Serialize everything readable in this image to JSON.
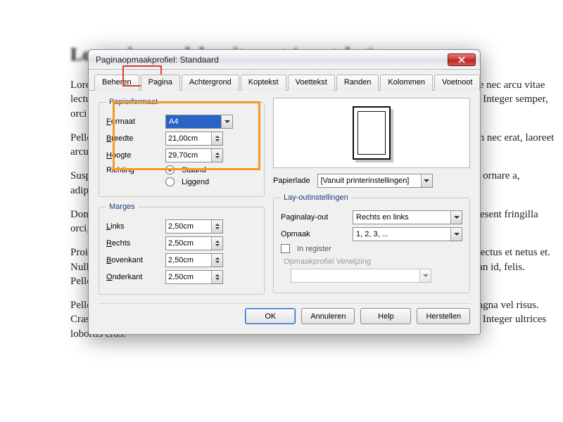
{
  "doc": {
    "title": "Lorem ipsum dolor sit amet (any tekst)",
    "para1": "Lorem ipsum dolor sit amet, consectetur adipiscing elit. Suspendisse at libero neque massa. Fusce nec arcu vitae lectus adipiscing vitae lorem. Sed aliquet faucibus pede, sit amet commodo magna tincidunt non. Integer semper, orci id tempor quis, lorem.",
    "para2": "Pellentesque habitant morbi tristique senectus et netus et malesuada fames ac turpis egestas. Proin nec erat, laoreet arcu. Aenean rhoncus imperdiet placerat. Cras sodales interdum, nec laoreet nulla.",
    "para3": "Suspendisse turpis. Sed sed nisi. Etiam cursus porttitor eros, ut interdum lacus mollis eget neque, ornare a, adipiscing nec, fermentum quis, aliquam eu, sodales tristique. Suspendisse dapibus.",
    "para4": "Donec quis purus. Ut velit leo, rransa eu, amet nec, commodo congue at libero. Lorem ipsum praesent fringilla orci, id semper ligula, at congue diam euismod eget, est nisl ac consequat. Etiam id felis.",
    "para5": "Proin consectet. Pellentesque habitant morbi tristique senectus et netus et malesuada tristique senectus et netus et. Nulla facilisi nulla orci aliquet. Aenean fringilla ante odio dolor, vulputate vel, auctor at, accumsan id, felis. Pellentesque cursus sagittis felis.",
    "para6": "Pellentesque porttitor, velit lacinia egestas auctor, diam eros tempus arcu, nec vulputate augue magna vel risus. Cras non magna vel ante adipiscing rhoncus. Vivamus a mi. Morbi neque. Aliquam erat volutpat. Integer ultrices lobortis eros."
  },
  "dialog": {
    "title": "Paginaopmaakprofiel: Standaard",
    "tabs": [
      "Beheren",
      "Pagina",
      "Achtergrond",
      "Koptekst",
      "Voettekst",
      "Randen",
      "Kolommen",
      "Voetnoot"
    ],
    "active_tab": 1,
    "paper": {
      "legend": "Papierformaat",
      "format_label": "Formaat",
      "format_value": "A4",
      "width_label": "Breedte",
      "width_value": "21,00cm",
      "height_label": "Hoogte",
      "height_value": "29,70cm",
      "orient_label": "Richting",
      "orient_port": "Staand",
      "orient_land": "Liggend",
      "tray_label": "Papierlade",
      "tray_value": "[Vanuit printerinstellingen]"
    },
    "margins": {
      "legend": "Marges",
      "left_label": "Links",
      "left_value": "2,50cm",
      "right_label": "Rechts",
      "right_value": "2,50cm",
      "top_label": "Bovenkant",
      "top_value": "2,50cm",
      "bottom_label": "Onderkant",
      "bottom_value": "2,50cm"
    },
    "layout": {
      "legend": "Lay-outinstellingen",
      "pagelay_label": "Paginalay-out",
      "pagelay_value": "Rechts en links",
      "format_label": "Opmaak",
      "format_value": "1, 2, 3, ...",
      "register_label": "In register",
      "refstyle_label": "Opmaakprofiel Verwijzing"
    },
    "buttons": {
      "ok": "OK",
      "cancel": "Annuleren",
      "help": "Help",
      "reset": "Herstellen"
    }
  }
}
